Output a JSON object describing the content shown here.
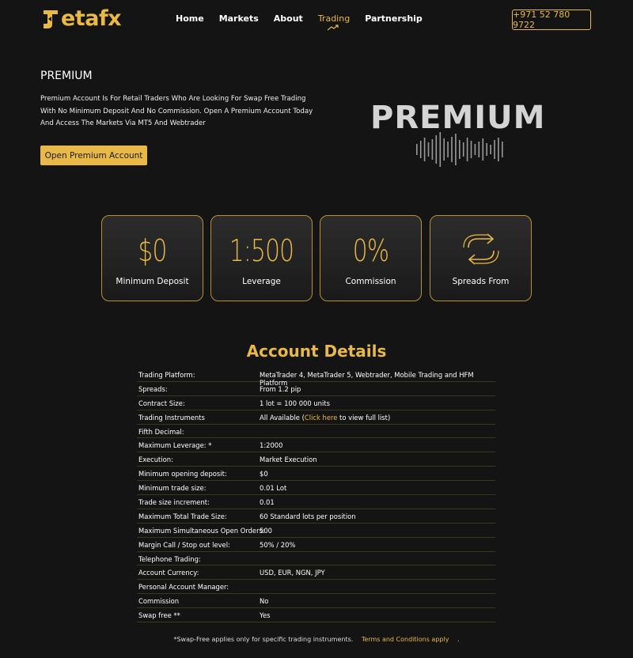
{
  "header": {
    "logo_text": "etafx",
    "nav": [
      "Home",
      "Markets",
      "About",
      "Trading",
      "Partnership"
    ],
    "active_nav": "Trading",
    "phone": "+971 52 780 9722"
  },
  "hero": {
    "title": "PREMIUM",
    "description": "Premium Account Is For Retail Traders Who Are Looking For Swap Free Trading With No Minimum Deposit And No Commission. Open A Premium Account Today And Access The Markets Via MT5 And Webtrader",
    "cta_label": "Open Premium Account",
    "wordmark": "PREMIUM"
  },
  "stats": [
    {
      "value": "$0",
      "label": "Minimum Deposit"
    },
    {
      "value": "1:500",
      "label": "Leverage"
    },
    {
      "value": "0%",
      "label": "Commission"
    },
    {
      "value": "",
      "label": "Spreads From",
      "icon": "exchange-arrows-icon"
    }
  ],
  "details": {
    "title": "Account Details",
    "rows": [
      {
        "k": "Trading Platform:",
        "v": "MetaTrader 4, MetaTrader 5, Webtrader, Mobile Trading and HFM Platform"
      },
      {
        "k": "Spreads:",
        "v": "From 1.2 pip"
      },
      {
        "k": "Contract Size:",
        "v": "1 lot = 100 000 units"
      },
      {
        "k": "Trading Instruments",
        "v": "All Available (",
        "link": "Click here",
        "v_after": " to view full list)"
      },
      {
        "k": "Fifth Decimal:",
        "v": ""
      },
      {
        "k": "Maximum Leverage: *",
        "v": "1:2000"
      },
      {
        "k": "Execution:",
        "v": "Market Execution"
      },
      {
        "k": "Minimum opening deposit:",
        "v": "$0"
      },
      {
        "k": "Minimum trade size:",
        "v": "0.01 Lot"
      },
      {
        "k": "Trade size increment:",
        "v": "0.01"
      },
      {
        "k": "Maximum Total Trade Size:",
        "v": "60 Standard lots per position"
      },
      {
        "k": "Maximum Simultaneous Open Orders:",
        "v": "500"
      },
      {
        "k": "Margin Call / Stop out level:",
        "v": "50% / 20%"
      },
      {
        "k": "Telephone Trading:",
        "v": ""
      },
      {
        "k": "Account Currency:",
        "v": "USD, EUR, NGN, JPY"
      },
      {
        "k": "Personal Account Manager:",
        "v": ""
      },
      {
        "k": "Commission",
        "v": "No"
      },
      {
        "k": "Swap free **",
        "v": "Yes"
      }
    ],
    "footnote": "*Swap-Free applies only for specific trading instruments.",
    "terms_link": "Terms and Conditions apply",
    "footnote_end": "."
  },
  "colors": {
    "accent": "#e8b947",
    "background": "#141414"
  }
}
